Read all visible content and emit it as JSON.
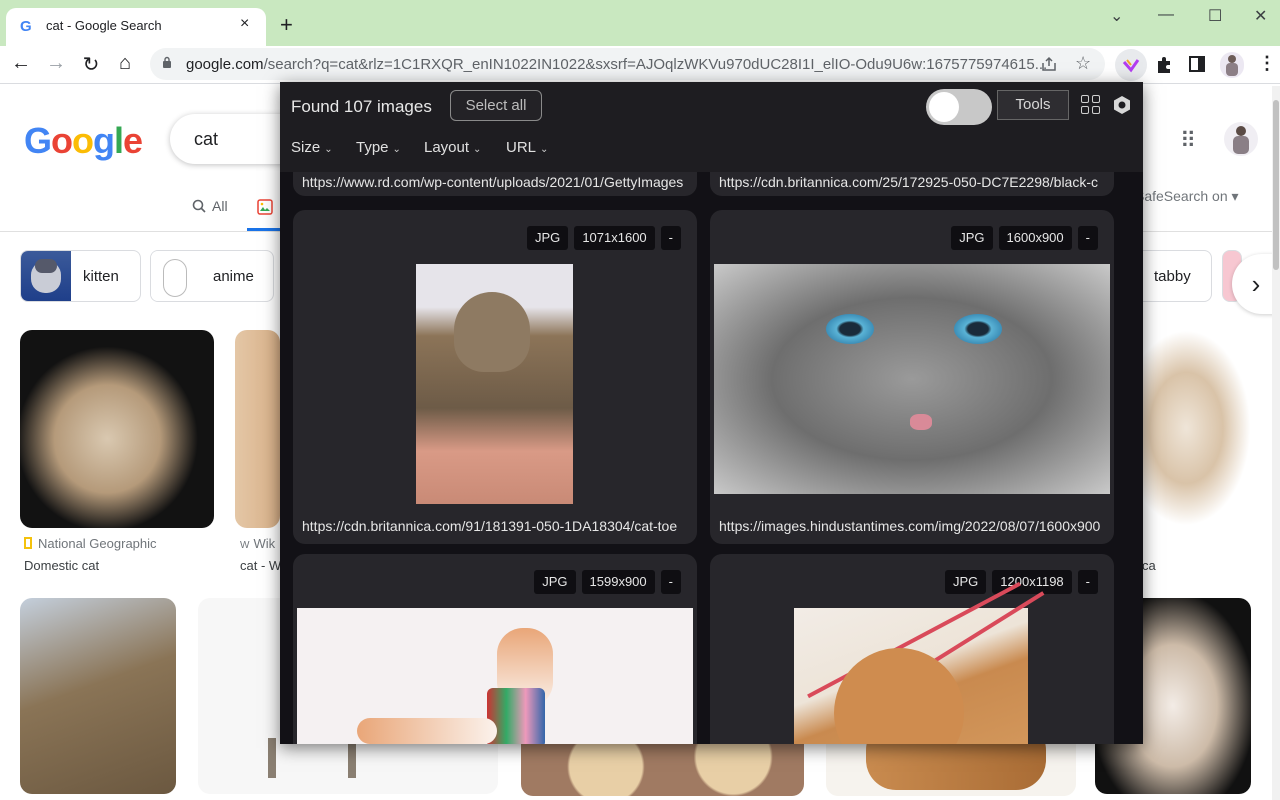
{
  "browser": {
    "tab_title": "cat - Google Search",
    "tab_close": "×",
    "new_tab": "+",
    "window_controls": {
      "tab_search": "⌄",
      "minimize": "—",
      "maximize": "☐",
      "close": "✕"
    },
    "nav": {
      "back": "←",
      "forward": "→",
      "reload": "↻",
      "home": "⌂"
    },
    "url_host": "google.com",
    "url_path": "/search?q=cat&rlz=1C1RXQR_enIN1022IN1022&sxsrf=AJOqlzWKVu970dUC28I1I_elIO-Odu9U6w:1675775974615...",
    "toolbar_icons": [
      "share-icon",
      "bookmark-star-icon",
      "extension-logo-icon",
      "extensions-puzzle-icon",
      "side-panel-icon",
      "profile-avatar-icon",
      "menu-kebab-icon"
    ]
  },
  "google": {
    "logo": [
      "G",
      "o",
      "o",
      "g",
      "l",
      "e"
    ],
    "logo_colors": [
      "#4285f4",
      "#ea4335",
      "#fbbc05",
      "#4285f4",
      "#34a853",
      "#ea4335"
    ],
    "query": "cat",
    "tabs": {
      "all": "All"
    },
    "safesearch": "SafeSearch on",
    "chips": [
      {
        "label": "kitten"
      },
      {
        "label": "anime"
      },
      {
        "label": "tabby"
      }
    ],
    "results": [
      {
        "source": "National Geographic",
        "title": "Domestic cat"
      },
      {
        "source": "Wik",
        "title": "cat - W"
      },
      {
        "source": "",
        "title": "ca"
      }
    ],
    "next_arrow": "›"
  },
  "extension": {
    "found_text": "Found 107 images",
    "select_all": "Select all",
    "tools": "Tools",
    "toggle_on": false,
    "filters": [
      "Size",
      "Type",
      "Layout",
      "URL"
    ],
    "top_urls": [
      "https://www.rd.com/wp-content/uploads/2021/01/GettyImages",
      "https://cdn.britannica.com/25/172925-050-DC7E2298/black-c"
    ],
    "cards": [
      {
        "format": "JPG",
        "dimensions": "1071x1600",
        "action": "-",
        "url": "https://cdn.britannica.com/91/181391-050-1DA18304/cat-toe"
      },
      {
        "format": "JPG",
        "dimensions": "1600x900",
        "action": "-",
        "url": "https://images.hindustantimes.com/img/2022/08/07/1600x900"
      },
      {
        "format": "JPG",
        "dimensions": "1599x900",
        "action": "-",
        "url": ""
      },
      {
        "format": "JPG",
        "dimensions": "1200x1198",
        "action": "-",
        "url": ""
      }
    ]
  }
}
